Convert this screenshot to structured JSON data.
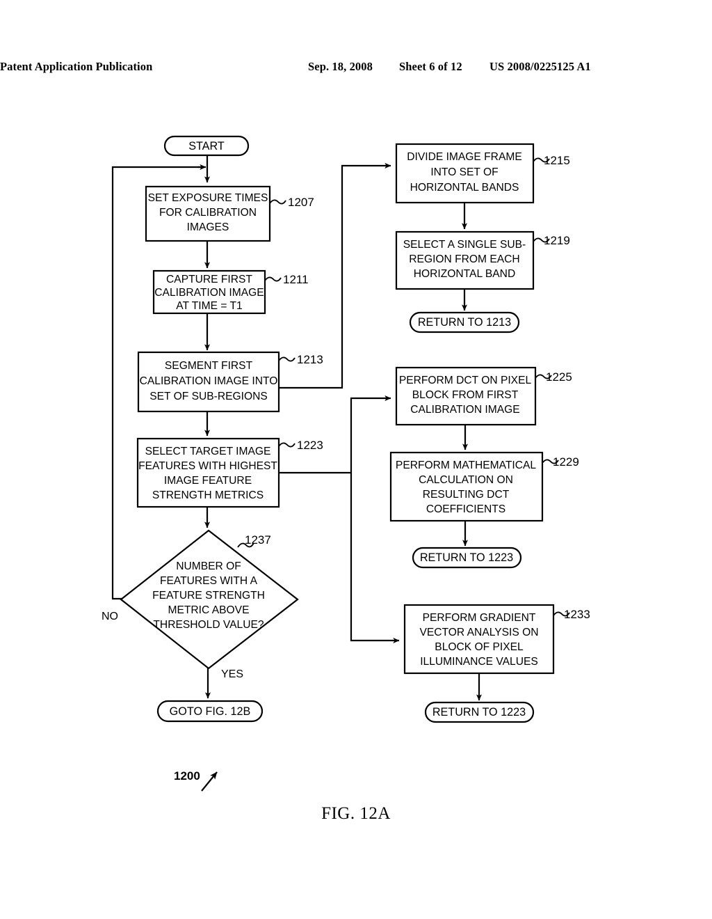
{
  "header": {
    "publication": "Patent Application Publication",
    "date": "Sep. 18, 2008",
    "sheet": "Sheet 6 of 12",
    "patent_number": "US 2008/0225125 A1"
  },
  "figure": {
    "caption": "FIG. 12A",
    "overall_reference": "1200"
  },
  "flowchart": {
    "start_terminator": "START",
    "nodes": [
      {
        "id": "1207",
        "shape": "process",
        "ref": "1207",
        "lines": [
          "SET EXPOSURE TIMES",
          "FOR CALIBRATION",
          "IMAGES"
        ]
      },
      {
        "id": "1211",
        "shape": "process",
        "ref": "1211",
        "lines": [
          "CAPTURE FIRST",
          "CALIBRATION IMAGE",
          "AT TIME = T1"
        ]
      },
      {
        "id": "1213",
        "shape": "process",
        "ref": "1213",
        "lines": [
          "SEGMENT FIRST",
          "CALIBRATION IMAGE INTO",
          "SET OF SUB-REGIONS"
        ]
      },
      {
        "id": "1223",
        "shape": "process",
        "ref": "1223",
        "lines": [
          "SELECT TARGET IMAGE",
          "FEATURES WITH HIGHEST",
          "IMAGE FEATURE",
          "STRENGTH METRICS"
        ]
      },
      {
        "id": "1237",
        "shape": "decision",
        "ref": "1237",
        "lines": [
          "NUMBER OF",
          "FEATURES WITH A",
          "FEATURE STRENGTH",
          "METRIC ABOVE",
          "THRESHOLD VALUE?"
        ]
      },
      {
        "id": "1215",
        "shape": "process",
        "ref": "1215",
        "lines": [
          "DIVIDE IMAGE FRAME",
          "INTO SET OF",
          "HORIZONTAL BANDS"
        ]
      },
      {
        "id": "1219",
        "shape": "process",
        "ref": "1219",
        "lines": [
          "SELECT A SINGLE SUB-",
          "REGION FROM EACH",
          "HORIZONTAL BAND"
        ]
      },
      {
        "id": "1225",
        "shape": "process",
        "ref": "1225",
        "lines": [
          "PERFORM DCT ON PIXEL",
          "BLOCK FROM FIRST",
          "CALIBRATION IMAGE"
        ]
      },
      {
        "id": "1229",
        "shape": "process",
        "ref": "1229",
        "lines": [
          "PERFORM MATHEMATICAL",
          "CALCULATION ON",
          "RESULTING DCT",
          "COEFFICIENTS"
        ]
      },
      {
        "id": "1233",
        "shape": "process",
        "ref": "1233",
        "lines": [
          "PERFORM GRADIENT",
          "VECTOR ANALYSIS ON",
          "BLOCK OF PIXEL",
          "ILLUMINANCE VALUES"
        ]
      }
    ],
    "terminators": [
      {
        "id": "goto-12b",
        "label": "GOTO FIG. 12B"
      },
      {
        "id": "return-1213",
        "label": "RETURN TO 1213"
      },
      {
        "id": "return-1223-a",
        "label": "RETURN TO 1223"
      },
      {
        "id": "return-1223-b",
        "label": "RETURN TO 1223"
      }
    ],
    "edge_labels": {
      "no": "NO",
      "yes": "YES"
    }
  }
}
